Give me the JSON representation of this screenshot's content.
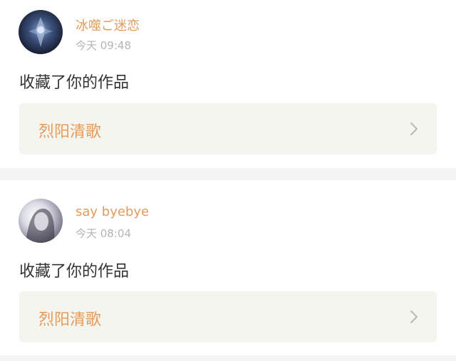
{
  "notifications": [
    {
      "username": "冰噬ご迷恋",
      "time": "今天 09:48",
      "action": "收藏了你的作品",
      "work_title": "烈阳清歌"
    },
    {
      "username": "say byebye",
      "time": "今天 08:04",
      "action": "收藏了你的作品",
      "work_title": "烈阳清歌"
    }
  ],
  "icons": {
    "chevron": "chevron-right-icon"
  },
  "colors": {
    "accent": "#e39a5d",
    "timestamp": "#b4b4b4",
    "text": "#333333",
    "card_link_bg": "#f5f5ef",
    "separator": "#f4f4f4"
  }
}
